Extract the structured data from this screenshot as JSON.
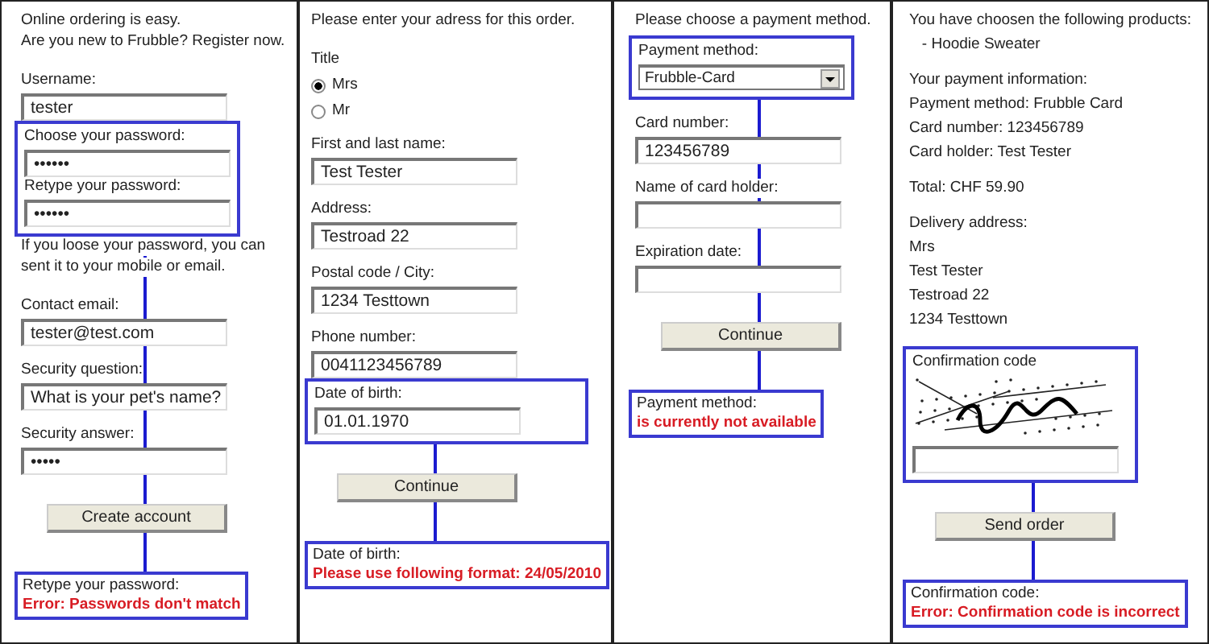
{
  "panels": [
    {
      "before": [
        {
          "kind": "lines",
          "lines": [
            "Online ordering is easy.",
            "Are you new to Frubble? Register now."
          ]
        },
        {
          "kind": "label",
          "text": "Username:"
        },
        {
          "kind": "field",
          "value": "tester"
        }
      ],
      "highlight": [
        {
          "kind": "label",
          "text": "Choose your password:"
        },
        {
          "kind": "field",
          "value": "••••••"
        },
        {
          "kind": "label",
          "text": "Retype your password:"
        },
        {
          "kind": "field",
          "value": "••••••"
        }
      ],
      "between": [
        {
          "kind": "lines",
          "lines": [
            "If you loose your password, you can",
            "sent it to your mobile or email."
          ]
        },
        {
          "kind": "label",
          "text": "Contact email:"
        },
        {
          "kind": "field",
          "value": "tester@test.com"
        },
        {
          "kind": "label",
          "text": "Security question:"
        },
        {
          "kind": "field",
          "value": "What is your pet's name?"
        },
        {
          "kind": "label",
          "text": "Security answer:"
        },
        {
          "kind": "field",
          "value": "•••••"
        },
        {
          "kind": "button",
          "text": "Create account"
        }
      ],
      "callout": {
        "label": "Retype your password:",
        "error": "Error: Passwords don't match"
      }
    },
    {
      "before": [
        {
          "kind": "lines",
          "lines": [
            "Please enter your adress for this order."
          ]
        },
        {
          "kind": "label",
          "text": "Title"
        },
        {
          "kind": "radio",
          "text": "Mrs",
          "selected": true
        },
        {
          "kind": "radio",
          "text": "Mr",
          "selected": false
        },
        {
          "kind": "label",
          "text": "First and last name:"
        },
        {
          "kind": "field",
          "value": "Test Tester"
        },
        {
          "kind": "label",
          "text": "Address:"
        },
        {
          "kind": "field",
          "value": "Testroad 22"
        },
        {
          "kind": "label",
          "text": "Postal code / City:"
        },
        {
          "kind": "field",
          "value": "1234 Testtown"
        },
        {
          "kind": "label",
          "text": "Phone number:"
        },
        {
          "kind": "field",
          "value": "0041123456789"
        }
      ],
      "highlight": [
        {
          "kind": "label",
          "text": "Date of birth:"
        },
        {
          "kind": "field",
          "value": "01.01.1970"
        }
      ],
      "between": [
        {
          "kind": "button",
          "text": "Continue"
        }
      ],
      "callout": {
        "label": "Date of birth:",
        "error": "Please use following format: 24/05/2010"
      }
    },
    {
      "before": [
        {
          "kind": "lines",
          "lines": [
            "Please choose a payment method."
          ]
        }
      ],
      "highlight": [
        {
          "kind": "label",
          "text": "Payment method:"
        },
        {
          "kind": "select",
          "value": "Frubble-Card"
        }
      ],
      "between": [
        {
          "kind": "label",
          "text": "Card number:"
        },
        {
          "kind": "field",
          "value": "123456789"
        },
        {
          "kind": "label",
          "text": "Name of card holder:"
        },
        {
          "kind": "field"
        },
        {
          "kind": "label",
          "text": "Expiration date:"
        },
        {
          "kind": "field"
        },
        {
          "kind": "button",
          "text": "Continue"
        }
      ],
      "callout": {
        "label": "Payment method:",
        "error": "is currently not available"
      }
    },
    {
      "before": [
        {
          "kind": "lines",
          "lines": [
            "You have choosen the following products:",
            "   - Hoodie Sweater"
          ]
        },
        {
          "kind": "lines",
          "lines": [
            "Your payment information:",
            "Payment method: Frubble Card",
            "Card number: 123456789",
            "Card holder: Test Tester"
          ]
        },
        {
          "kind": "lines",
          "lines": [
            "Total: CHF 59.90"
          ]
        },
        {
          "kind": "lines",
          "lines": [
            "Delivery address:",
            "Mrs",
            "Test Tester",
            "Testroad 22",
            "1234 Testtown"
          ]
        }
      ],
      "highlight": [
        {
          "kind": "label",
          "text": "Confirmation code"
        },
        {
          "kind": "picture"
        },
        {
          "kind": "field"
        }
      ],
      "between": [
        {
          "kind": "button",
          "text": "Send order"
        }
      ],
      "callout": {
        "label": "Confirmation code:",
        "error": "Error: Confirmation code is incorrect"
      }
    }
  ]
}
